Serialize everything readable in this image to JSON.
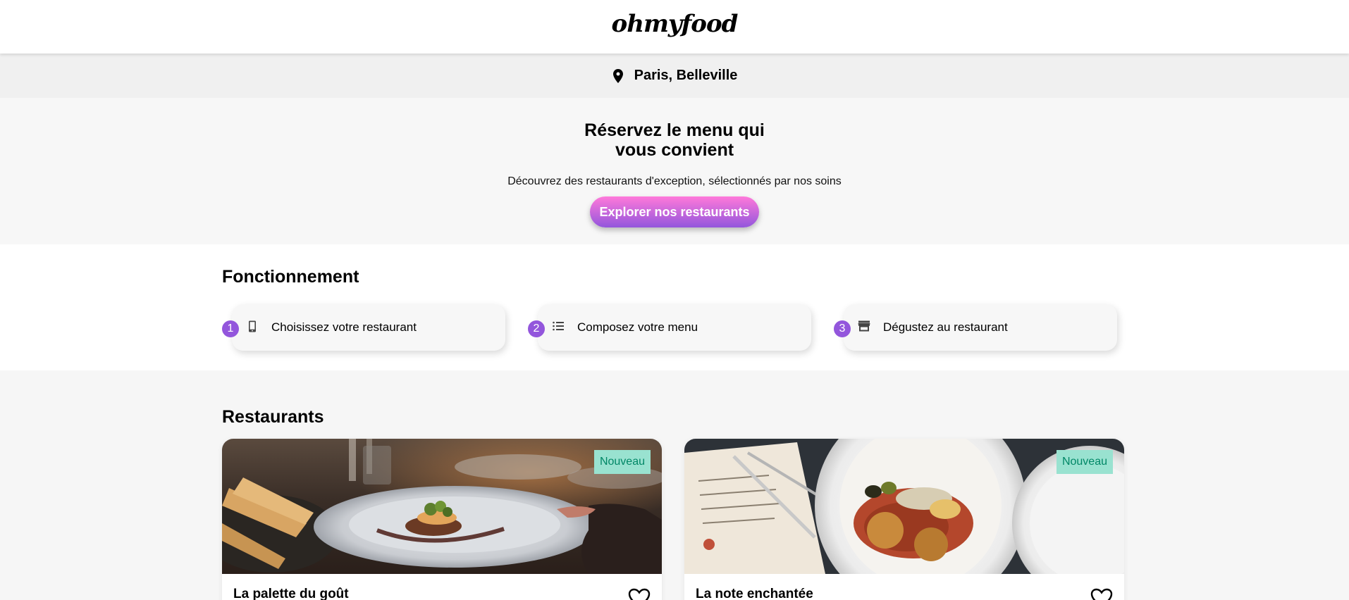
{
  "header": {
    "logo_text": "ohmyfood"
  },
  "location": {
    "icon": "map-pin-icon",
    "text": "Paris, Belleville"
  },
  "hero": {
    "title_line1": "Réservez le menu qui",
    "title_line2": "vous convient",
    "subtitle": "Découvrez des restaurants d'exception, sélectionnés par nos soins",
    "cta_label": "Explorer nos restaurants"
  },
  "how": {
    "title": "Fonctionnement",
    "steps": [
      {
        "number": "1",
        "icon": "mobile-phone-icon",
        "label": "Choisissez votre restaurant"
      },
      {
        "number": "2",
        "icon": "list-icon",
        "label": "Composez votre menu"
      },
      {
        "number": "3",
        "icon": "store-icon",
        "label": "Dégustez au restaurant"
      }
    ]
  },
  "restaurants": {
    "title": "Restaurants",
    "items": [
      {
        "name": "La palette du goût",
        "badge": "Nouveau",
        "image": "restaurant-plate-photo",
        "favorite_icon": "heart-icon"
      },
      {
        "name": "La note enchantée",
        "badge": "Nouveau",
        "image": "restaurant-meal-photo",
        "favorite_icon": "heart-icon"
      }
    ]
  },
  "colors": {
    "accent_purple": "#9356DC",
    "accent_pink": "#FF79DA",
    "badge_bg": "#99E2D0",
    "badge_text": "#008766"
  }
}
